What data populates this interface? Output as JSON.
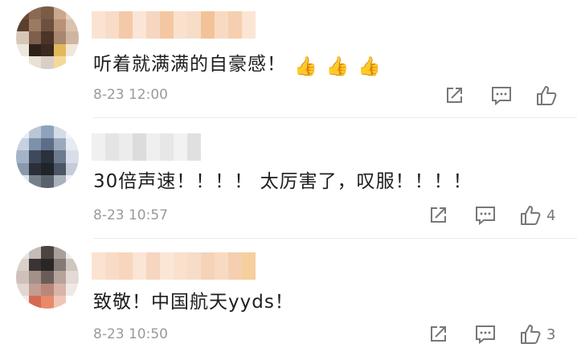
{
  "comments": [
    {
      "text": "听着就满满的自豪感！",
      "emoji": [
        "👍",
        "👍",
        "👍"
      ],
      "time": "8-23 12:00",
      "likes": ""
    },
    {
      "text": "30倍声速！！！！ 太厉害了，叹服！！！！",
      "emoji": [],
      "time": "8-23 10:57",
      "likes": "4"
    },
    {
      "text": "致敬！中国航天yyds！",
      "emoji": [],
      "time": "8-23 10:50",
      "likes": "3"
    }
  ],
  "icons": {
    "share": "share-icon",
    "reply": "comment-icon",
    "like": "thumbs-up-icon"
  },
  "colors": {
    "text": "#1e1e1e",
    "meta": "#9a9a9a",
    "icon": "#777777"
  }
}
